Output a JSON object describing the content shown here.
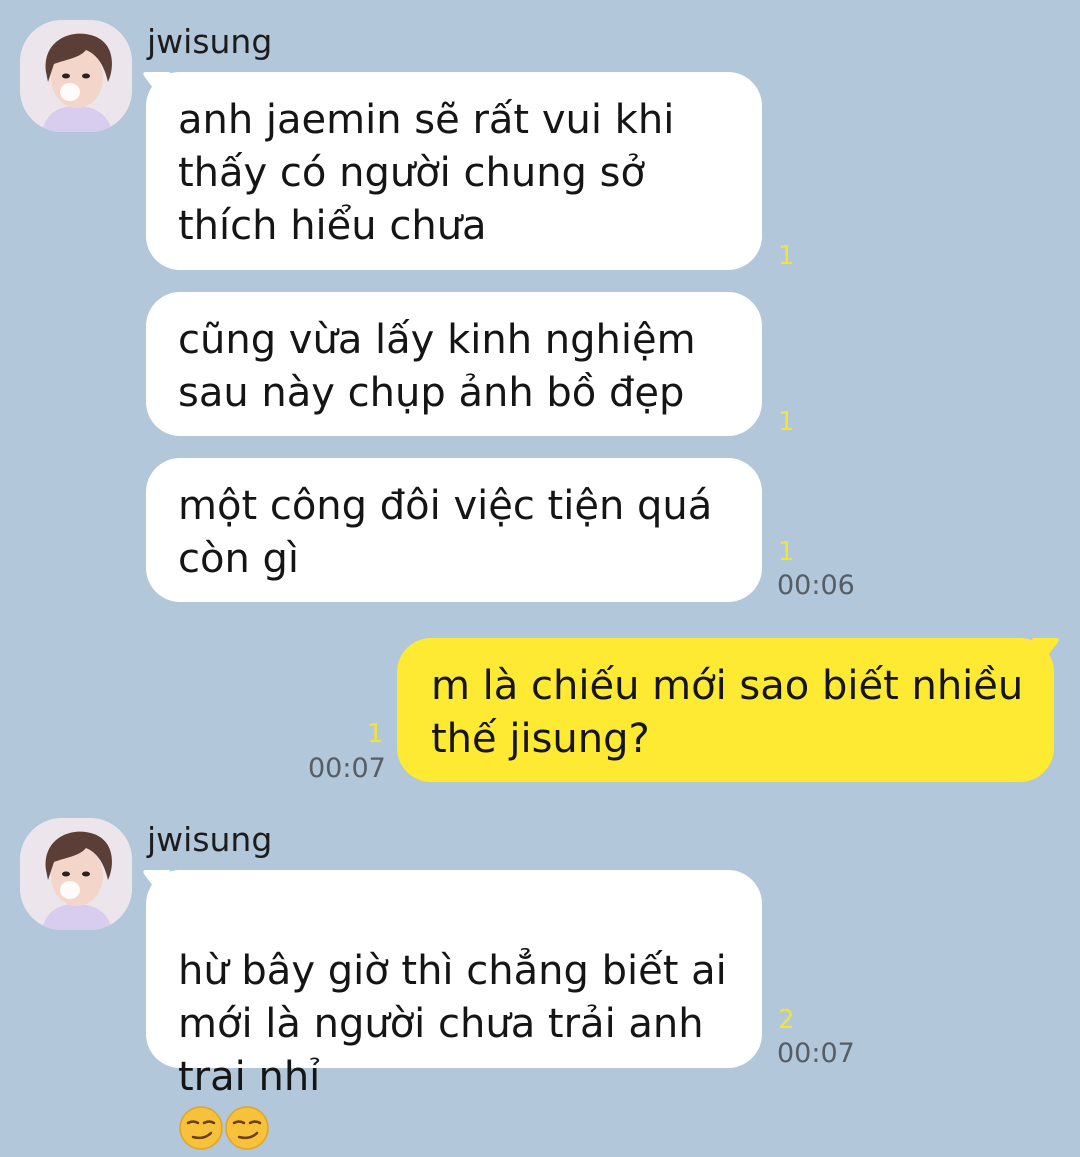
{
  "colors": {
    "background": "#b2c7da",
    "incoming_bubble": "#ffffff",
    "outgoing_bubble": "#fee933",
    "unread_count": "#f2e33a",
    "timestamp": "#555d66"
  },
  "groups": [
    {
      "sender": "jwisung",
      "avatar_icon": "profile-photo-avatar",
      "messages": [
        {
          "text": "anh jaemin sẽ rất vui khi\nthấy có người chung sở\nthích hiểu chưa",
          "unread": "1",
          "time": ""
        },
        {
          "text": "cũng vừa lấy kinh nghiệm\nsau này chụp ảnh bồ đẹp",
          "unread": "1",
          "time": ""
        },
        {
          "text": "một công đôi việc tiện quá\ncòn gì",
          "unread": "1",
          "time": "00:06"
        }
      ]
    },
    {
      "sender": "me",
      "messages": [
        {
          "text": "m là chiếu mới sao biết nhiều\nthế jisung?",
          "unread": "1",
          "time": "00:07"
        }
      ]
    },
    {
      "sender": "jwisung",
      "avatar_icon": "profile-photo-avatar",
      "messages": [
        {
          "text": "hừ bây giờ thì chẳng biết ai\nmới là người chưa trải anh\ntrai nhỉ",
          "emoji": [
            "smirking-face-emoji",
            "smirking-face-emoji"
          ],
          "unread": "2",
          "time": "00:07"
        }
      ]
    }
  ]
}
